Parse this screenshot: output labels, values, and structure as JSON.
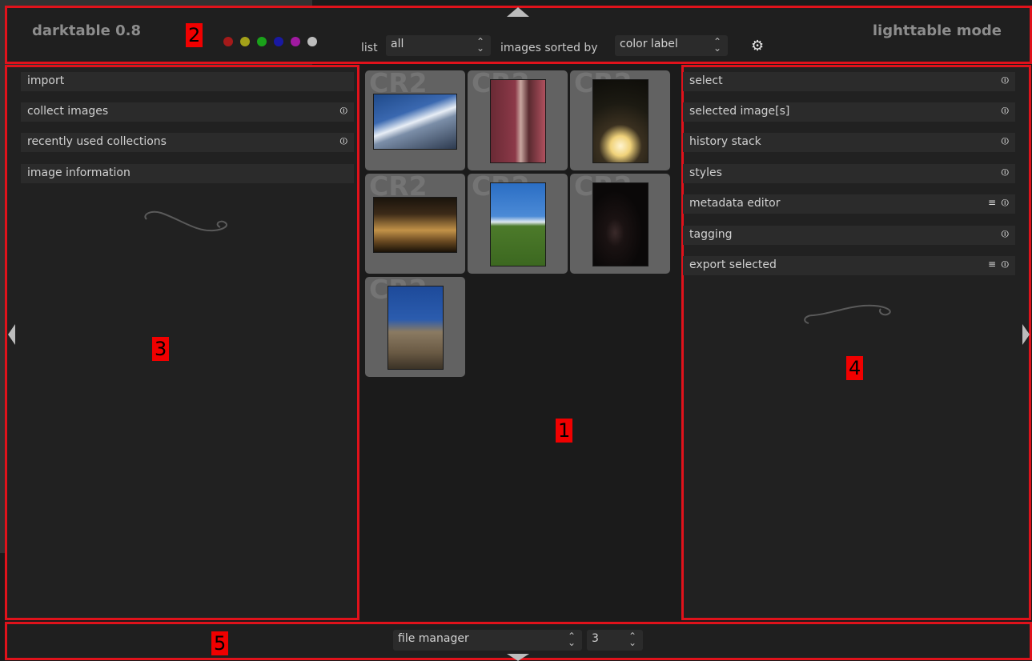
{
  "header": {
    "app_title": "darktable 0.8",
    "mode_title": "lighttable mode",
    "color_labels": [
      {
        "name": "red",
        "color": "#a41a1a"
      },
      {
        "name": "yellow",
        "color": "#a3a119"
      },
      {
        "name": "green",
        "color": "#1aa21a"
      },
      {
        "name": "blue",
        "color": "#1919a2"
      },
      {
        "name": "purple",
        "color": "#a11aa1"
      },
      {
        "name": "gray",
        "color": "#bdbdbd"
      }
    ],
    "list_label": "list",
    "list_value": "all",
    "sort_label": "images sorted by",
    "sort_value": "color label",
    "settings_icon": "gear-icon"
  },
  "left_panel": {
    "modules": [
      {
        "label": "import",
        "icon": ""
      },
      {
        "label": "collect images",
        "icon": "reset-icon"
      },
      {
        "label": "recently used collections",
        "icon": "reset-icon"
      },
      {
        "label": "image information",
        "icon": ""
      }
    ]
  },
  "right_panel": {
    "modules": [
      {
        "label": "select",
        "icon": "reset-icon"
      },
      {
        "label": "selected image[s]",
        "icon": "reset-icon"
      },
      {
        "label": "history stack",
        "icon": "reset-icon"
      },
      {
        "label": "styles",
        "icon": "reset-icon"
      },
      {
        "label": "metadata editor",
        "icon": "presets-reset-icon"
      },
      {
        "label": "tagging",
        "icon": "reset-icon"
      },
      {
        "label": "export selected",
        "icon": "presets-reset-icon"
      }
    ]
  },
  "center": {
    "thumbnails": [
      {
        "ext": "CR2",
        "subject": "snowy mountain"
      },
      {
        "ext": "CR2",
        "subject": "red alley"
      },
      {
        "ext": "CR2",
        "subject": "glowing spheres"
      },
      {
        "ext": "CR2",
        "subject": "lit building at night"
      },
      {
        "ext": "CR2",
        "subject": "green hill with sky"
      },
      {
        "ext": "CR2",
        "subject": "dark doorway"
      },
      {
        "ext": "CR2",
        "subject": "church tower"
      }
    ]
  },
  "footer": {
    "view_select": "file manager",
    "zoom_value": "3"
  },
  "icons": {
    "reset": "⏼",
    "presets": "≡"
  },
  "annotations": {
    "labels": [
      "1",
      "2",
      "3",
      "4",
      "5"
    ]
  }
}
